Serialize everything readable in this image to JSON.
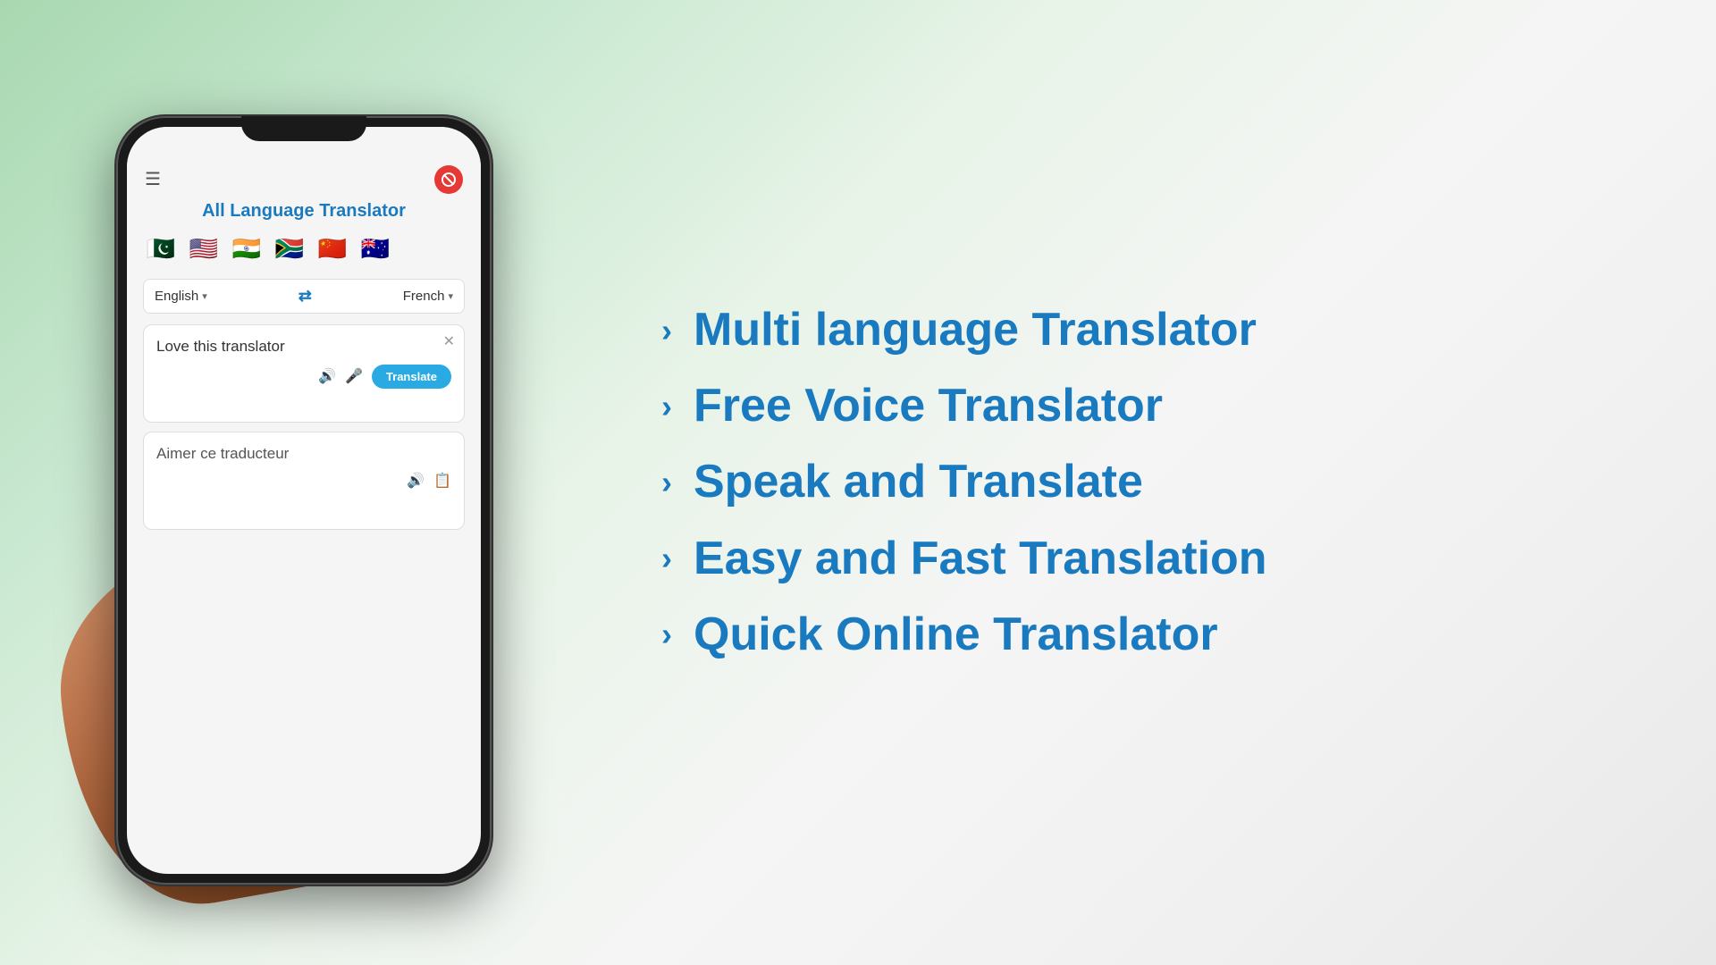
{
  "app": {
    "title": "All Language Translator",
    "source_language": "English",
    "target_language": "French",
    "input_text": "Love this translator",
    "output_text": "Aimer ce traducteur",
    "translate_button": "Translate",
    "flags": [
      "🇵🇰",
      "🇺🇸",
      "🇮🇳",
      "🇿🇦",
      "🇨🇳",
      "🇦🇺"
    ]
  },
  "features": [
    {
      "id": 1,
      "text": "Multi language Translator"
    },
    {
      "id": 2,
      "text": "Free Voice Translator"
    },
    {
      "id": 3,
      "text": "Speak and Translate"
    },
    {
      "id": 4,
      "text": "Easy and Fast Translation"
    },
    {
      "id": 5,
      "text": "Quick Online Translator"
    }
  ]
}
